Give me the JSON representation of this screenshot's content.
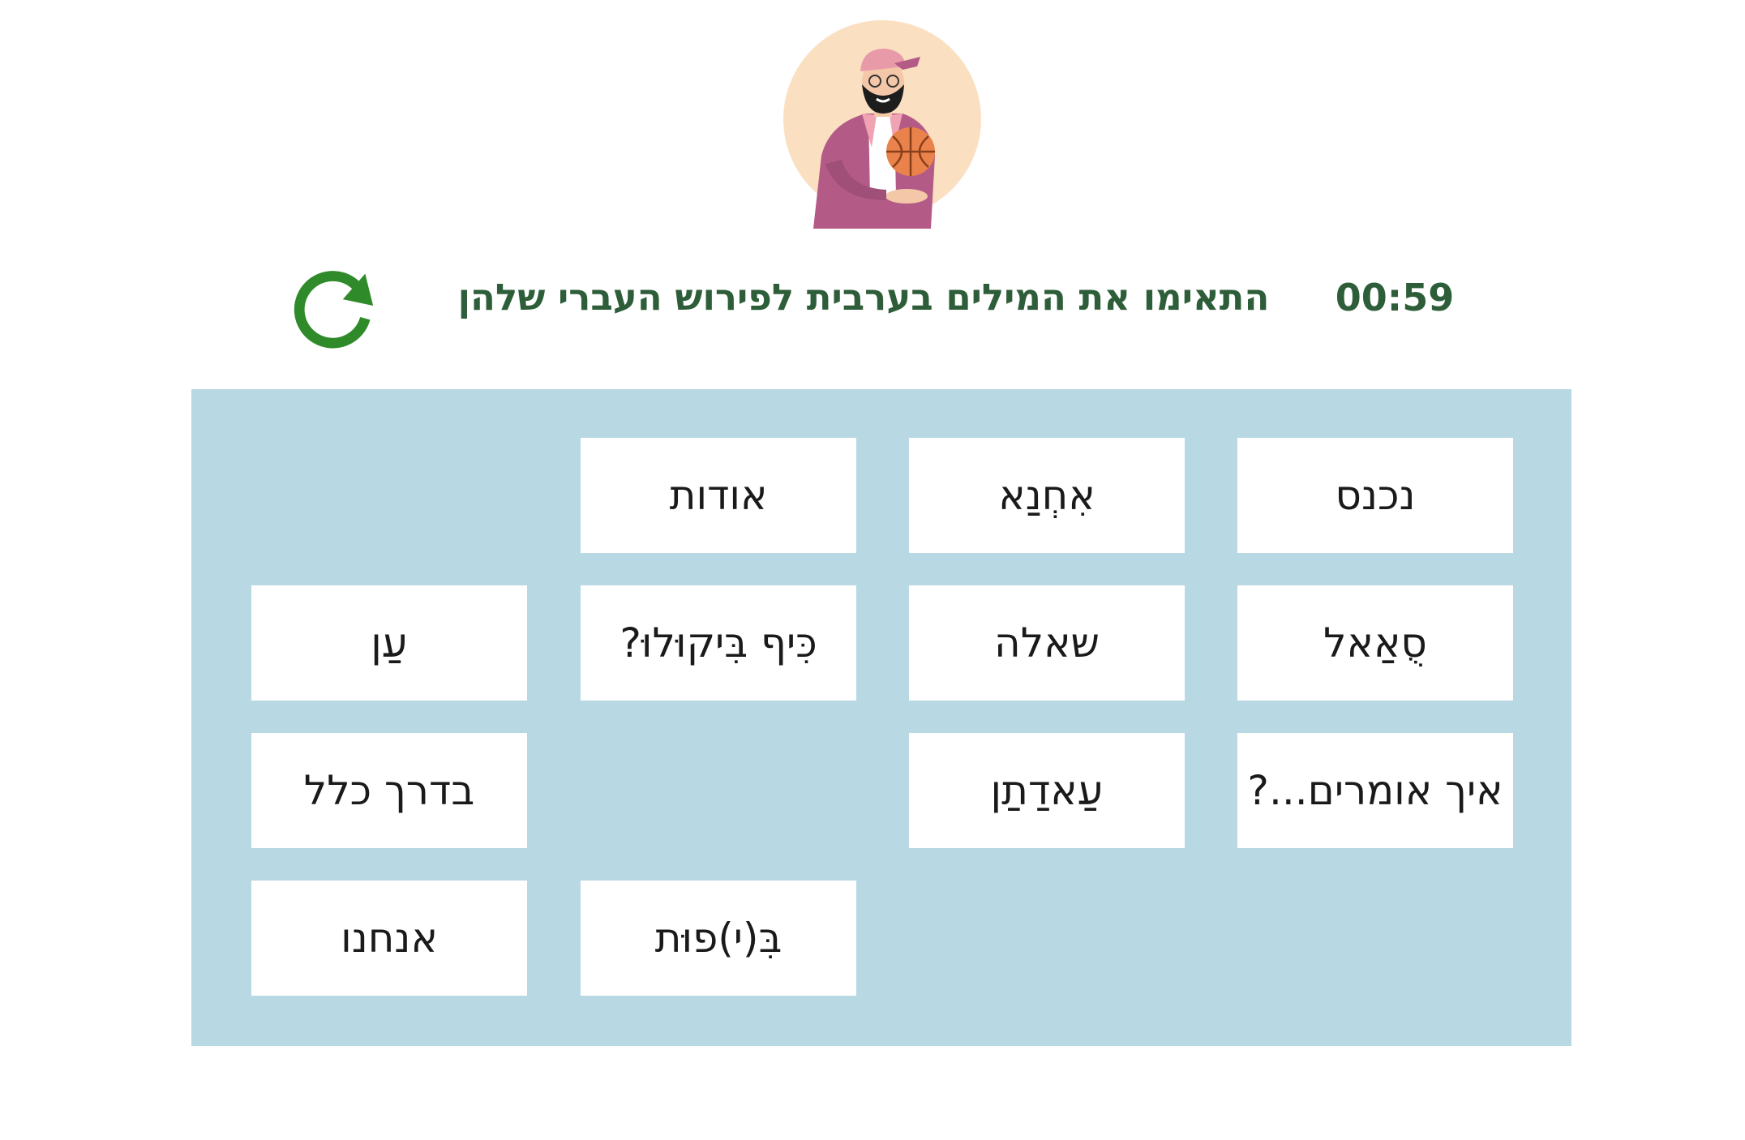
{
  "header": {
    "instruction": "התאימו את המילים בערבית לפירוש העברי שלהן",
    "timer": "00:59"
  },
  "icons": {
    "refresh": "refresh-icon",
    "avatar": "character-with-basketball"
  },
  "colors": {
    "title": "#2e5e39",
    "refresh": "#2f8a2a",
    "board": "#b8d9e4",
    "card": "#ffffff",
    "avatar_bg": "#fbdfc1"
  },
  "cards": [
    {
      "label": "נכנס"
    },
    {
      "label": "אִחְנַא"
    },
    {
      "label": "אודות"
    },
    {
      "label": "סֻאַאל"
    },
    {
      "label": "שאלה"
    },
    {
      "label": "כִּיף בִּיקוּלוּ?"
    },
    {
      "label": "עַן"
    },
    {
      "label": "איך אומרים...?"
    },
    {
      "label": "עַאדַתַן"
    },
    {
      "label": "בדרך כלל"
    },
    {
      "label": "בִּ(י)פוּת"
    },
    {
      "label": "אנחנו"
    }
  ]
}
